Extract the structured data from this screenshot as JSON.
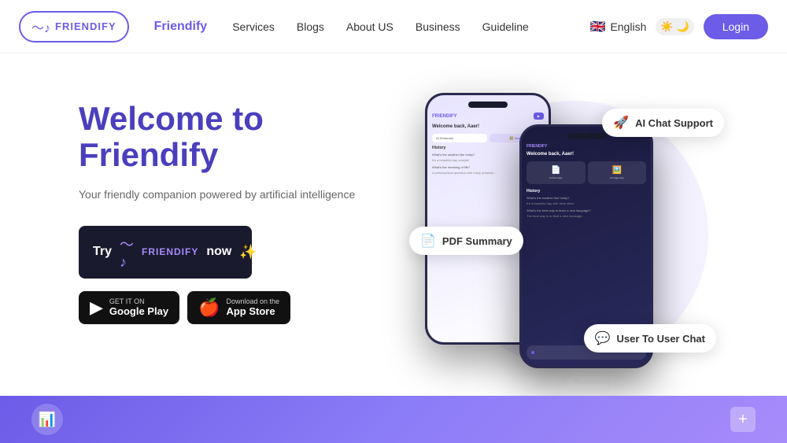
{
  "navbar": {
    "logo_text": "FRIENDIFY",
    "brand": "Friendify",
    "links": [
      {
        "label": "Services",
        "id": "services"
      },
      {
        "label": "Blogs",
        "id": "blogs"
      },
      {
        "label": "About US",
        "id": "about"
      },
      {
        "label": "Business",
        "id": "business"
      },
      {
        "label": "Guideline",
        "id": "guideline"
      }
    ],
    "language": "English",
    "login_label": "Login"
  },
  "hero": {
    "title_line1": "Welcome to",
    "title_line2": "Friendify",
    "subtitle": "Your friendly companion powered by artificial intelligence",
    "try_label": "Try",
    "brand_small": "FRIENDIFY",
    "now_label": "now",
    "google_play_top": "GET IT ON",
    "google_play_bottom": "Google Play",
    "app_store_top": "Download on the",
    "app_store_bottom": "App Store"
  },
  "badges": {
    "ai_chat": "AI Chat Support",
    "pdf_summary": "PDF Summary",
    "user_chat": "User To User Chat"
  },
  "phone1": {
    "title": "FRIENDIFY",
    "welcome": "Welcome back, Aaer!",
    "history_label": "History",
    "q1": "What's the weather like today?",
    "a1": "It's a beautiful day outside!",
    "q2": "What's the meaning of life?",
    "a2": "A philosophical question with many answers..."
  },
  "phone2": {
    "header": "FRIENDIFY",
    "welcome": "Welcome back, Aaer!",
    "feature1_icon": "📄",
    "feature1_label": "AI Summary",
    "feature2_icon": "🖼️",
    "feature2_label": "AI Image App",
    "history_label": "History",
    "q1": "What's the weather like today?",
    "a1": "It's a beautiful day with clear skies",
    "q2": "What's the best way to learn a new language?",
    "a2": "The best way is to start a new message..."
  }
}
